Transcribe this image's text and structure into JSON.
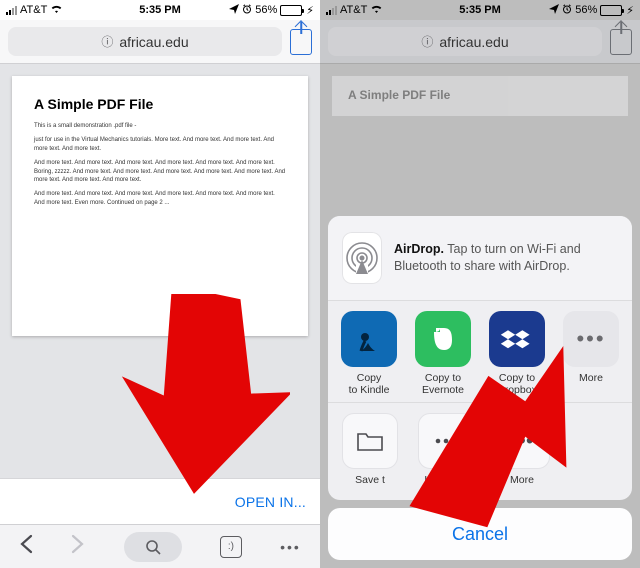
{
  "status": {
    "carrier": "AT&T",
    "time": "5:35 PM",
    "battery_pct": "56%"
  },
  "url": {
    "domain": "africau.edu"
  },
  "pdf": {
    "title": "A Simple PDF File",
    "p1": "This is a small demonstration .pdf file -",
    "p2": "just for use in the Virtual Mechanics tutorials. More text. And more text. And more text. And more text. And more text.",
    "p3": "And more text. And more text. And more text. And more text. And more text. And more text. Boring, zzzzz. And more text. And more text. And more text. And more text. And more text. And more text. And more text. And more text.",
    "p4": "And more text. And more text. And more text. And more text. And more text. And more text. And more text. Even more. Continued on page 2 ..."
  },
  "openin": {
    "label": "OPEN IN..."
  },
  "share": {
    "airdrop_bold": "AirDrop.",
    "airdrop_text": " Tap to turn on Wi-Fi and Bluetooth to share with AirDrop.",
    "apps": [
      {
        "label": "Copy\nto Kindle"
      },
      {
        "label": "Copy to\nEvernote"
      },
      {
        "label": "Copy to\nDropbox"
      },
      {
        "label": "More"
      }
    ],
    "actions": [
      {
        "label": "Save t"
      },
      {
        "label": "LastPass"
      },
      {
        "label": "More"
      }
    ],
    "cancel": "Cancel"
  }
}
